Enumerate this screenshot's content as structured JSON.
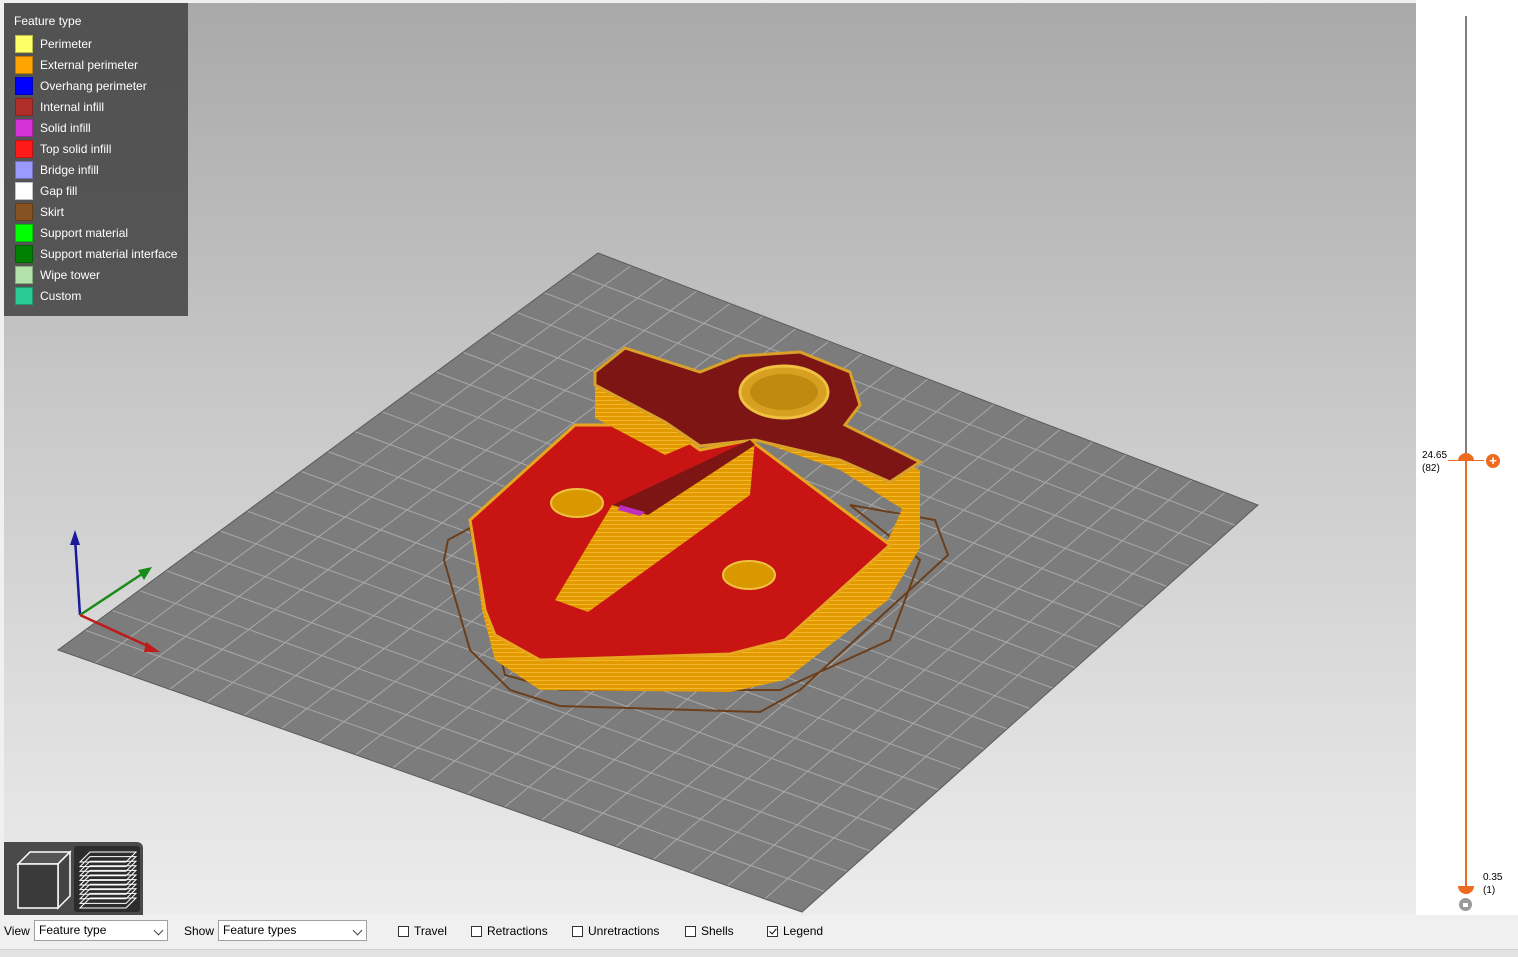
{
  "legend": {
    "title": "Feature type",
    "items": [
      {
        "label": "Perimeter",
        "color": "#ffff66"
      },
      {
        "label": "External perimeter",
        "color": "#ffa500"
      },
      {
        "label": "Overhang perimeter",
        "color": "#0000ff"
      },
      {
        "label": "Internal infill",
        "color": "#b03029"
      },
      {
        "label": "Solid infill",
        "color": "#d732d7"
      },
      {
        "label": "Top solid infill",
        "color": "#ff1a1a"
      },
      {
        "label": "Bridge infill",
        "color": "#9999ff"
      },
      {
        "label": "Gap fill",
        "color": "#ffffff"
      },
      {
        "label": "Skirt",
        "color": "#845321"
      },
      {
        "label": "Support material",
        "color": "#00ff00"
      },
      {
        "label": "Support material interface",
        "color": "#008000"
      },
      {
        "label": "Wipe tower",
        "color": "#b3e3ab"
      },
      {
        "label": "Custom",
        "color": "#28cc94"
      }
    ]
  },
  "layer_slider": {
    "top_value": "24.65",
    "top_layer": "(82)",
    "bottom_value": "0.35",
    "bottom_layer": "(1)",
    "accent_color": "#ed6b21"
  },
  "view_buttons": {
    "icons": [
      "3d-view-icon",
      "layers-view-icon"
    ]
  },
  "bottom_bar": {
    "view_label": "View",
    "view_value": "Feature type",
    "show_label": "Show",
    "show_value": "Feature types",
    "checkboxes": [
      {
        "label": "Travel",
        "checked": false
      },
      {
        "label": "Retractions",
        "checked": false
      },
      {
        "label": "Unretractions",
        "checked": false
      },
      {
        "label": "Shells",
        "checked": false
      },
      {
        "label": "Legend",
        "checked": true
      }
    ]
  }
}
